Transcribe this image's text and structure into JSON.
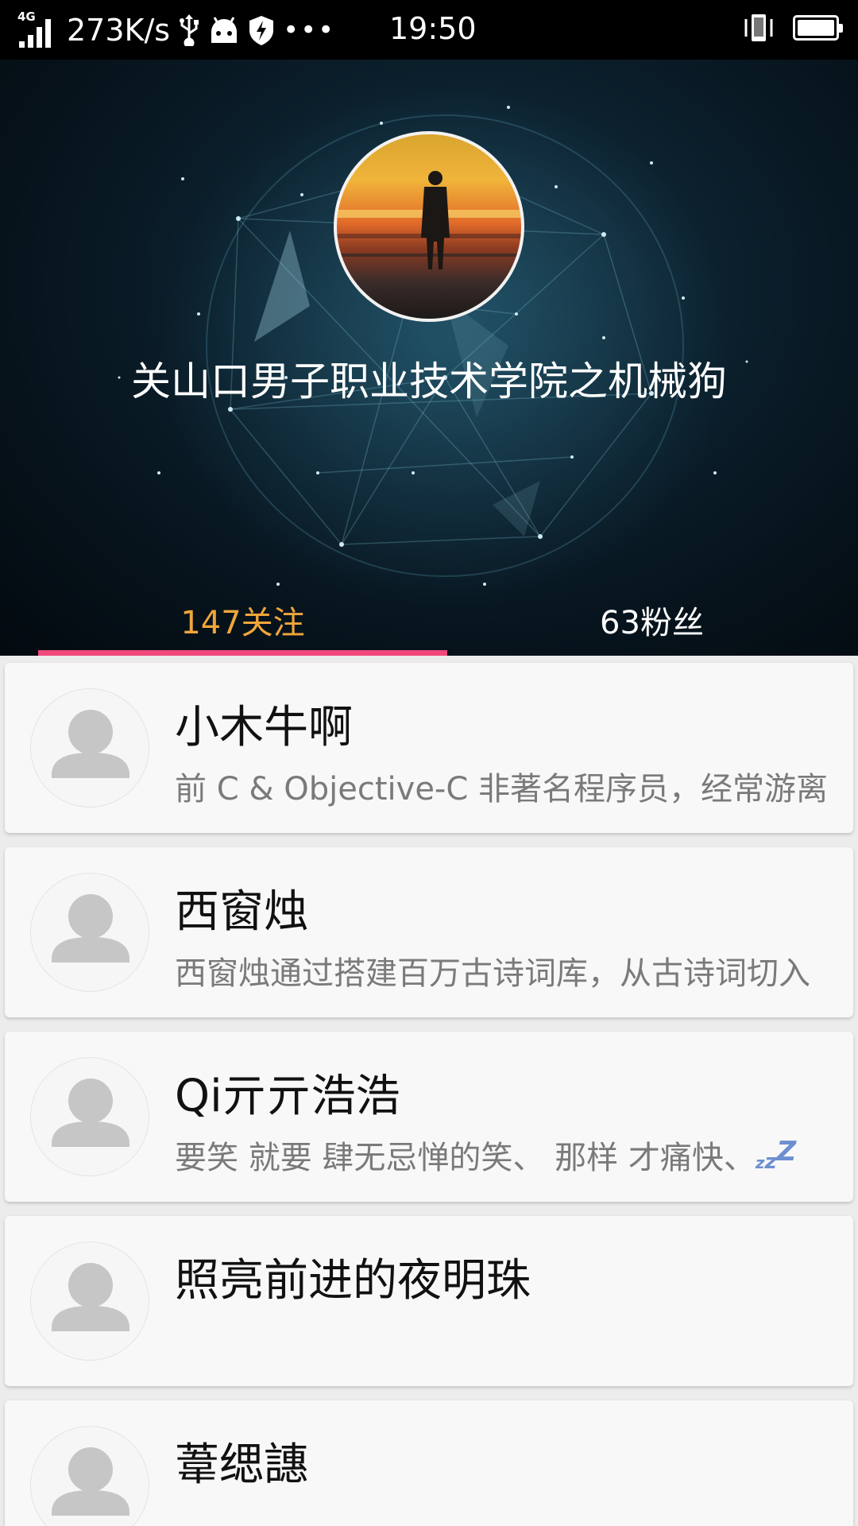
{
  "status_bar": {
    "network_type": "4G",
    "speed": "273K/s",
    "time": "19:50",
    "icons": [
      "usb-icon",
      "android-icon",
      "shield-icon",
      "more-dots-icon",
      "vibrate-icon",
      "battery-icon"
    ]
  },
  "profile": {
    "username": "关山口男子职业技术学院之机械狗",
    "tabs": [
      {
        "label": "147关注",
        "active": true
      },
      {
        "label": "63粉丝",
        "active": false
      }
    ],
    "colors": {
      "active_tab": "#f0a63b",
      "indicator": "#f0487a"
    }
  },
  "users": [
    {
      "name": "小木牛啊",
      "bio": "前 C & Objective-C 非著名程序员，经常游离"
    },
    {
      "name": "西窗烛",
      "bio": "西窗烛通过搭建百万古诗词库，从古诗词切入"
    },
    {
      "name": "Qi亓亓浩浩",
      "bio": "要笑 就要 肆无忌惮的笑、 那样 才痛快、"
    },
    {
      "name": "照亮前进的夜明珠",
      "bio": ""
    },
    {
      "name": "葦缌譓",
      "bio": ""
    }
  ]
}
